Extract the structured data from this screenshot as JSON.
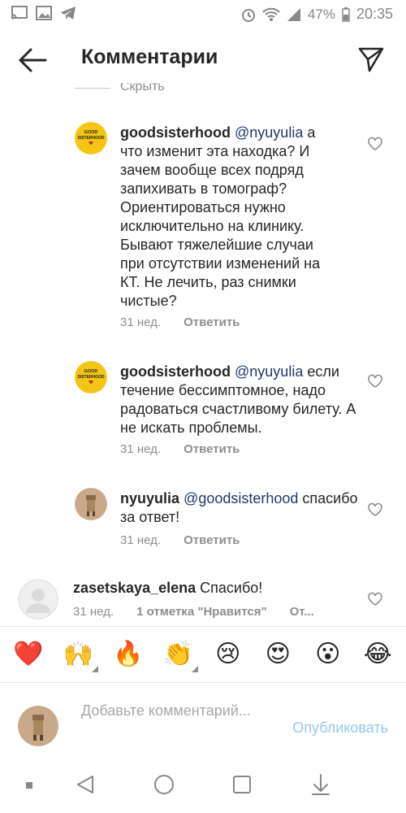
{
  "status": {
    "battery": "47%",
    "time": "20:35"
  },
  "header": {
    "title": "Комментарии"
  },
  "hide_replies": "Скрыть ответы",
  "comments": [
    {
      "user": "goodsisterhood",
      "mention": "@nyuyulia",
      "text_after_mention": " а что изменит эта находка? И зачем вообще всех подряд запихивать в томограф? Ориентироваться нужно исключительно на клинику. Бывают тяжелейшие случаи при отсутствии изменений на КТ. Не лечить, раз снимки чистые?",
      "time": "31 нед.",
      "reply": "Ответить"
    },
    {
      "user": "goodsisterhood",
      "mention": "@nyuyulia",
      "text_after_mention": " если течение бессимптомное, надо радоваться счастливому билету. А не искать проблемы.",
      "time": "31 нед.",
      "reply": "Ответить"
    },
    {
      "user": "nyuyulia",
      "mention": "@goodsisterhood",
      "text_after_mention": " спасибо за ответ!",
      "time": "31 нед.",
      "reply": "Ответить"
    },
    {
      "user": "zasetskaya_elena",
      "text": " Спасибо!",
      "time": "31 нед.",
      "likes": "1 отметка \"Нравится\"",
      "reply": "От..."
    }
  ],
  "emojis": [
    "❤️",
    "🙌",
    "🔥",
    "👏",
    "😢",
    "😍",
    "😮",
    "😂"
  ],
  "composer": {
    "placeholder": "Добавьте комментарий...",
    "publish": "Опубликовать"
  },
  "colors": {
    "mention": "#1f3a6b",
    "publish": "#98c7ef",
    "muted": "#8e8e8e"
  }
}
